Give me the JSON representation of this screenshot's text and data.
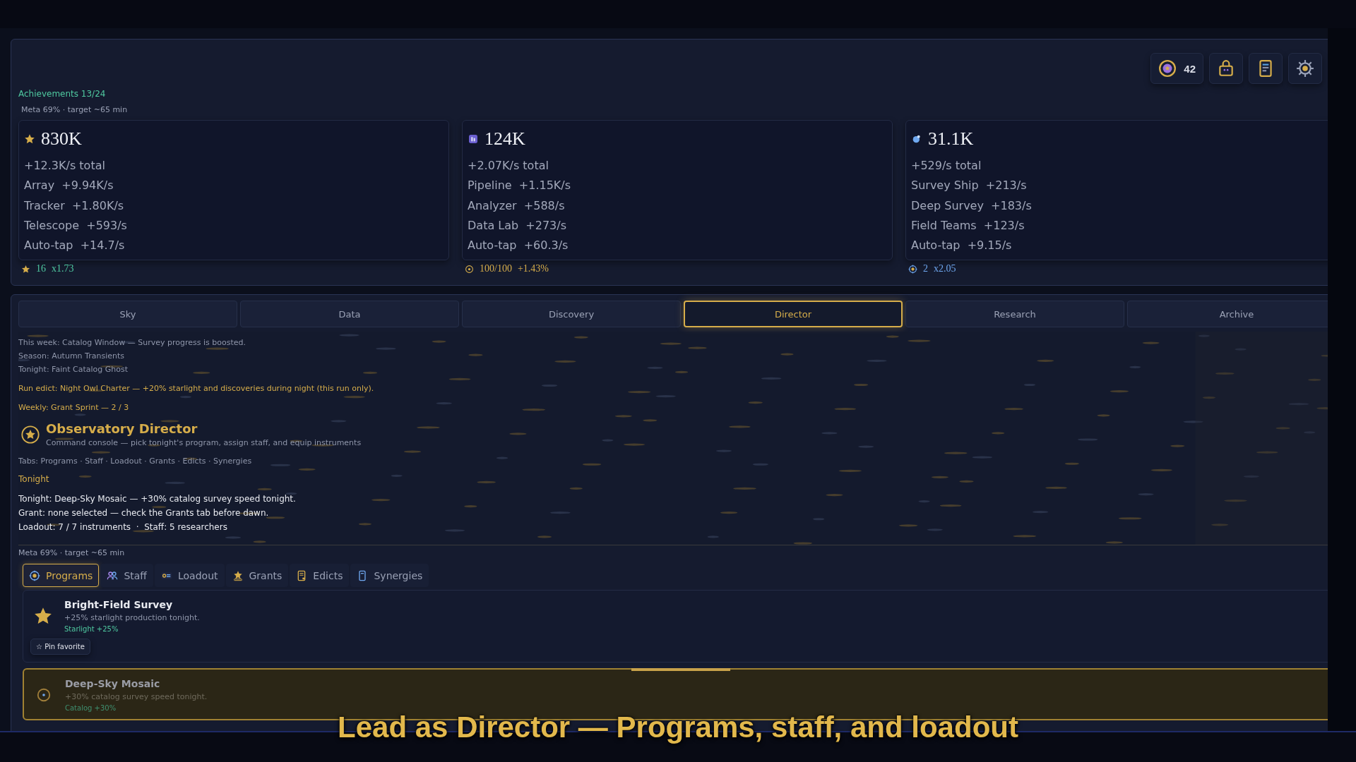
{
  "header": {
    "badges": [
      {
        "kind": "coin",
        "text": "42"
      },
      {
        "kind": "shop"
      },
      {
        "kind": "log"
      },
      {
        "kind": "settings"
      }
    ]
  },
  "achievements": "Achievements 13/24",
  "meta": "Meta 69% · target ~65 min",
  "resources": [
    {
      "kind": "star",
      "amount": "830K",
      "total": "+12.3K/s total",
      "sources": [
        {
          "name": "Array",
          "rate": "+9.94K/s"
        },
        {
          "name": "Tracker",
          "rate": "+1.80K/s"
        },
        {
          "name": "Telescope",
          "rate": "+593/s"
        },
        {
          "name": "Auto-tap",
          "rate": "+14.7/s"
        }
      ],
      "footer": [
        "16",
        "x1.73"
      ],
      "color": "#4fc9a0"
    },
    {
      "kind": "data",
      "amount": "124K",
      "total": "+2.07K/s total",
      "sources": [
        {
          "name": "Pipeline",
          "rate": "+1.15K/s"
        },
        {
          "name": "Analyzer",
          "rate": "+588/s"
        },
        {
          "name": "Data Lab",
          "rate": "+273/s"
        },
        {
          "name": "Auto-tap",
          "rate": "+60.3/s"
        }
      ],
      "footer": [
        "100/100",
        "+1.43%"
      ],
      "color": "#d6ad4a"
    },
    {
      "kind": "drop",
      "amount": "31.1K",
      "total": "+529/s total",
      "sources": [
        {
          "name": "Survey Ship",
          "rate": "+213/s"
        },
        {
          "name": "Deep Survey",
          "rate": "+183/s"
        },
        {
          "name": "Field Teams",
          "rate": "+123/s"
        },
        {
          "name": "Auto-tap",
          "rate": "+9.15/s"
        }
      ],
      "footer": [
        "2",
        "x2.05"
      ],
      "color": "#6fa8f0"
    }
  ],
  "main_tabs": [
    {
      "label": "Sky",
      "selected": false
    },
    {
      "label": "Data",
      "selected": false
    },
    {
      "label": "Discovery",
      "selected": false
    },
    {
      "label": "Director",
      "selected": true
    },
    {
      "label": "Research",
      "selected": false
    },
    {
      "label": "Archive",
      "selected": false
    }
  ],
  "notices": [
    {
      "kind": "info",
      "text": "This week: Catalog Window — Survey progress is boosted."
    },
    {
      "kind": "info",
      "text": "Season: Autumn Transients"
    },
    {
      "kind": "info",
      "text": "Tonight: Faint Catalog Ghost"
    },
    {
      "kind": "edict",
      "text": "Run edict: Night Owl Charter — +20% starlight and discoveries during night (this run only)."
    },
    {
      "kind": "weekly",
      "text": "Weekly: Grant Sprint — 2 / 3"
    }
  ],
  "director": {
    "title": "Observatory Director",
    "subtitle": "Command console — pick tonight's program, assign staff, and equip instruments",
    "tabs_hint": "Tabs: Programs · Staff · Loadout · Grants · Edicts · Synergies",
    "section": "Tonight",
    "summary": [
      "Tonight: Deep-Sky Mosaic — +30% catalog survey speed tonight.",
      "Grant: none selected — check the Grants tab before dawn.",
      "Loadout: 7 / 7 instruments  ·  Staff: 5 researchers"
    ]
  },
  "meta_footer": "Meta 69% · target ~65 min",
  "sub_tabs": [
    {
      "label": "Programs",
      "selected": true
    },
    {
      "label": "Staff",
      "selected": false
    },
    {
      "label": "Loadout",
      "selected": false
    },
    {
      "label": "Grants",
      "selected": false
    },
    {
      "label": "Edicts",
      "selected": false
    },
    {
      "label": "Synergies",
      "selected": false
    }
  ],
  "programs": [
    {
      "name": "Bright-Field Survey",
      "description": "+25% starlight production tonight.",
      "effect": "Starlight +25%",
      "action": "☆ Pin favorite",
      "selected": false
    },
    {
      "name": "Deep-Sky Mosaic",
      "description": "+30% catalog survey speed tonight.",
      "effect": "Catalog +30%",
      "selected": true
    }
  ],
  "caption": "Lead as Director — Programs, staff, and loadout"
}
